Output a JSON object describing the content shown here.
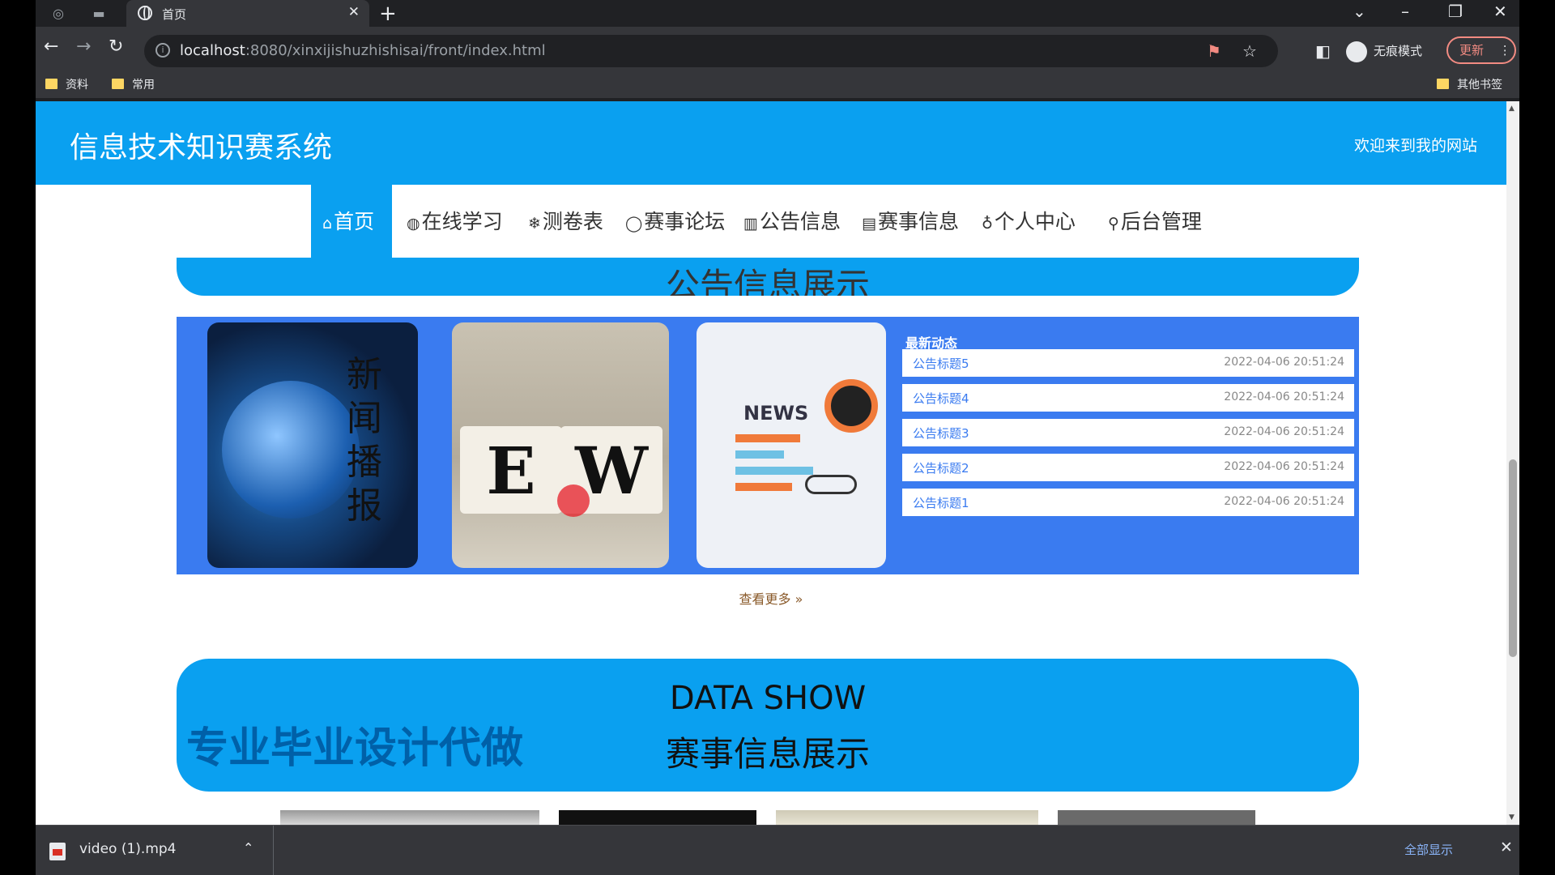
{
  "browser": {
    "tab_title": "首页",
    "new_tab_symbol": "+",
    "close_symbol": "✕",
    "url_host": "localhost",
    "url_path": ":8080/xinxijishuzhishisai/front/index.html",
    "incognito_label": "无痕模式",
    "update_label": "更新",
    "bookmarks": [
      "资料",
      "常用"
    ],
    "other_bookmarks": "其他书签"
  },
  "site": {
    "title": "信息技术知识赛系统",
    "welcome": "欢迎来到我的网站"
  },
  "nav": {
    "items": [
      {
        "icon": "⌂",
        "label": "首页"
      },
      {
        "icon": "◍",
        "label": "在线学习"
      },
      {
        "icon": "❄",
        "label": "测卷表"
      },
      {
        "icon": "◯",
        "label": "赛事论坛"
      },
      {
        "icon": "▥",
        "label": "公告信息"
      },
      {
        "icon": "▤",
        "label": "赛事信息"
      },
      {
        "icon": "♁",
        "label": "个人中心"
      },
      {
        "icon": "⚲",
        "label": "后台管理"
      }
    ]
  },
  "notice_section": {
    "title_cut": "公告信息展示",
    "image1_text": "新闻播报",
    "image2_letters": [
      "E",
      "W"
    ],
    "image3_text": "NEWS",
    "latest_title": "最新动态",
    "items": [
      {
        "title": "公告标题5",
        "date": "2022-04-06 20:51:24"
      },
      {
        "title": "公告标题4",
        "date": "2022-04-06 20:51:24"
      },
      {
        "title": "公告标题3",
        "date": "2022-04-06 20:51:24"
      },
      {
        "title": "公告标题2",
        "date": "2022-04-06 20:51:24"
      },
      {
        "title": "公告标题1",
        "date": "2022-04-06 20:51:24"
      }
    ],
    "more_label": "查看更多 »"
  },
  "data_section": {
    "en_title": "DATA SHOW",
    "cn_title": "赛事信息展示",
    "ad_text": "专业毕业设计代做"
  },
  "downloads": {
    "file_name": "video (1).mp4",
    "show_all": "全部显示"
  },
  "colors": {
    "brand_blue": "#0aa0f0",
    "panel_blue": "#3a7bf0"
  }
}
